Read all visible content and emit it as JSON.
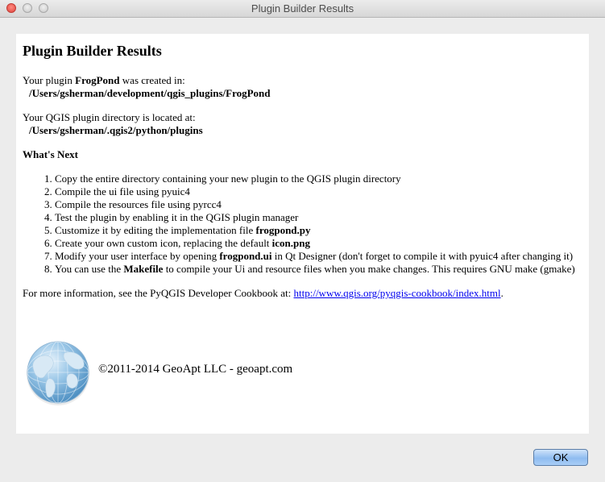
{
  "window": {
    "title": "Plugin Builder Results"
  },
  "content": {
    "heading": "Plugin Builder Results",
    "created": {
      "prefix": "Your plugin ",
      "plugin_name": "FrogPond",
      "suffix": " was created in:",
      "path": "/Users/gsherman/development/qgis_plugins/FrogPond"
    },
    "plugin_dir": {
      "label": "Your QGIS plugin directory is located at:",
      "path": "/Users/gsherman/.qgis2/python/plugins"
    },
    "whats_next_heading": "What's Next",
    "steps": [
      {
        "text": "Copy the entire directory containing your new plugin to the QGIS plugin directory"
      },
      {
        "text": "Compile the ui file using pyuic4"
      },
      {
        "text": "Compile the resources file using pyrcc4"
      },
      {
        "text": "Test the plugin by enabling it in the QGIS plugin manager"
      },
      {
        "pre": "Customize it by editing the implementation file ",
        "bold": "frogpond.py",
        "post": ""
      },
      {
        "pre": "Create your own custom icon, replacing the default ",
        "bold": "icon.png",
        "post": ""
      },
      {
        "pre": "Modify your user interface by opening ",
        "bold": "frogpond.ui",
        "post": " in Qt Designer (don't forget to compile it with pyuic4 after changing it)"
      },
      {
        "pre": "You can use the ",
        "bold": "Makefile",
        "post": " to compile your Ui and resource files when you make changes. This requires GNU make (gmake)"
      }
    ],
    "more_info": {
      "prefix": "For more information, see the PyQGIS Developer Cookbook at: ",
      "link_text": "http://www.qgis.org/pyqgis-cookbook/index.html",
      "suffix": "."
    },
    "copyright": "©2011-2014 GeoApt LLC - geoapt.com"
  },
  "buttons": {
    "ok": "OK"
  }
}
